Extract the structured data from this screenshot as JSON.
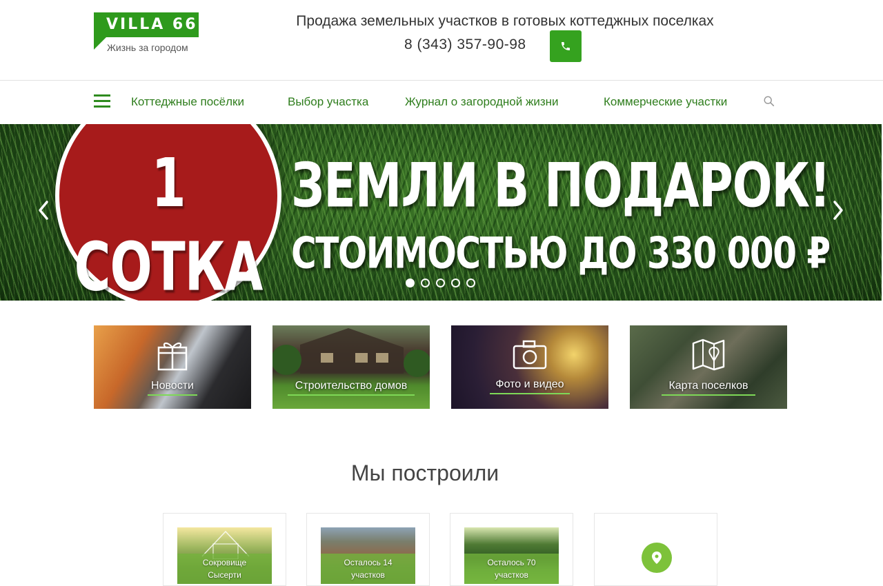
{
  "header": {
    "logo_text": "VILLA 66",
    "logo_sub": "Жизнь за городом",
    "tagline": "Продажа земельных участков в готовых коттеджных поселках",
    "phone": "8 (343) 357-90-98",
    "phone_icon": "phone-icon"
  },
  "nav": {
    "items": [
      {
        "label": "Коттеджные посёлки"
      },
      {
        "label": "Выбор участка"
      },
      {
        "label": "Журнал о загородной жизни"
      },
      {
        "label": "Коммерческие участки"
      }
    ],
    "search_icon": "search-icon",
    "menu_icon": "hamburger-icon"
  },
  "slider": {
    "circle_text": "1 СОТКА",
    "line1": "ЗЕМЛИ В ПОДАРОК!",
    "line2": "СТОИМОСТЬЮ ДО 330 000 ₽",
    "dots_count": 5,
    "active_dot": 1
  },
  "tiles": [
    {
      "label": "Новости",
      "icon": "gift-icon"
    },
    {
      "label": "Строительство домов",
      "icon": "house-icon"
    },
    {
      "label": "Фото и видео",
      "icon": "camera-icon"
    },
    {
      "label": "Карта поселков",
      "icon": "map-icon"
    }
  ],
  "built": {
    "title": "Мы построили",
    "cards": [
      {
        "line1": "Сокровище",
        "line2": "Сысерти"
      },
      {
        "line1": "Осталось 14",
        "line2": "участков"
      },
      {
        "line1": "Осталось 70",
        "line2": "участков"
      },
      {
        "icon": "map-pin-icon"
      }
    ]
  },
  "colors": {
    "brand_green": "#2e9a1c",
    "nav_text": "#2e7d1c",
    "banner_red": "#a71b1b",
    "pin_green": "#7dc23a"
  }
}
